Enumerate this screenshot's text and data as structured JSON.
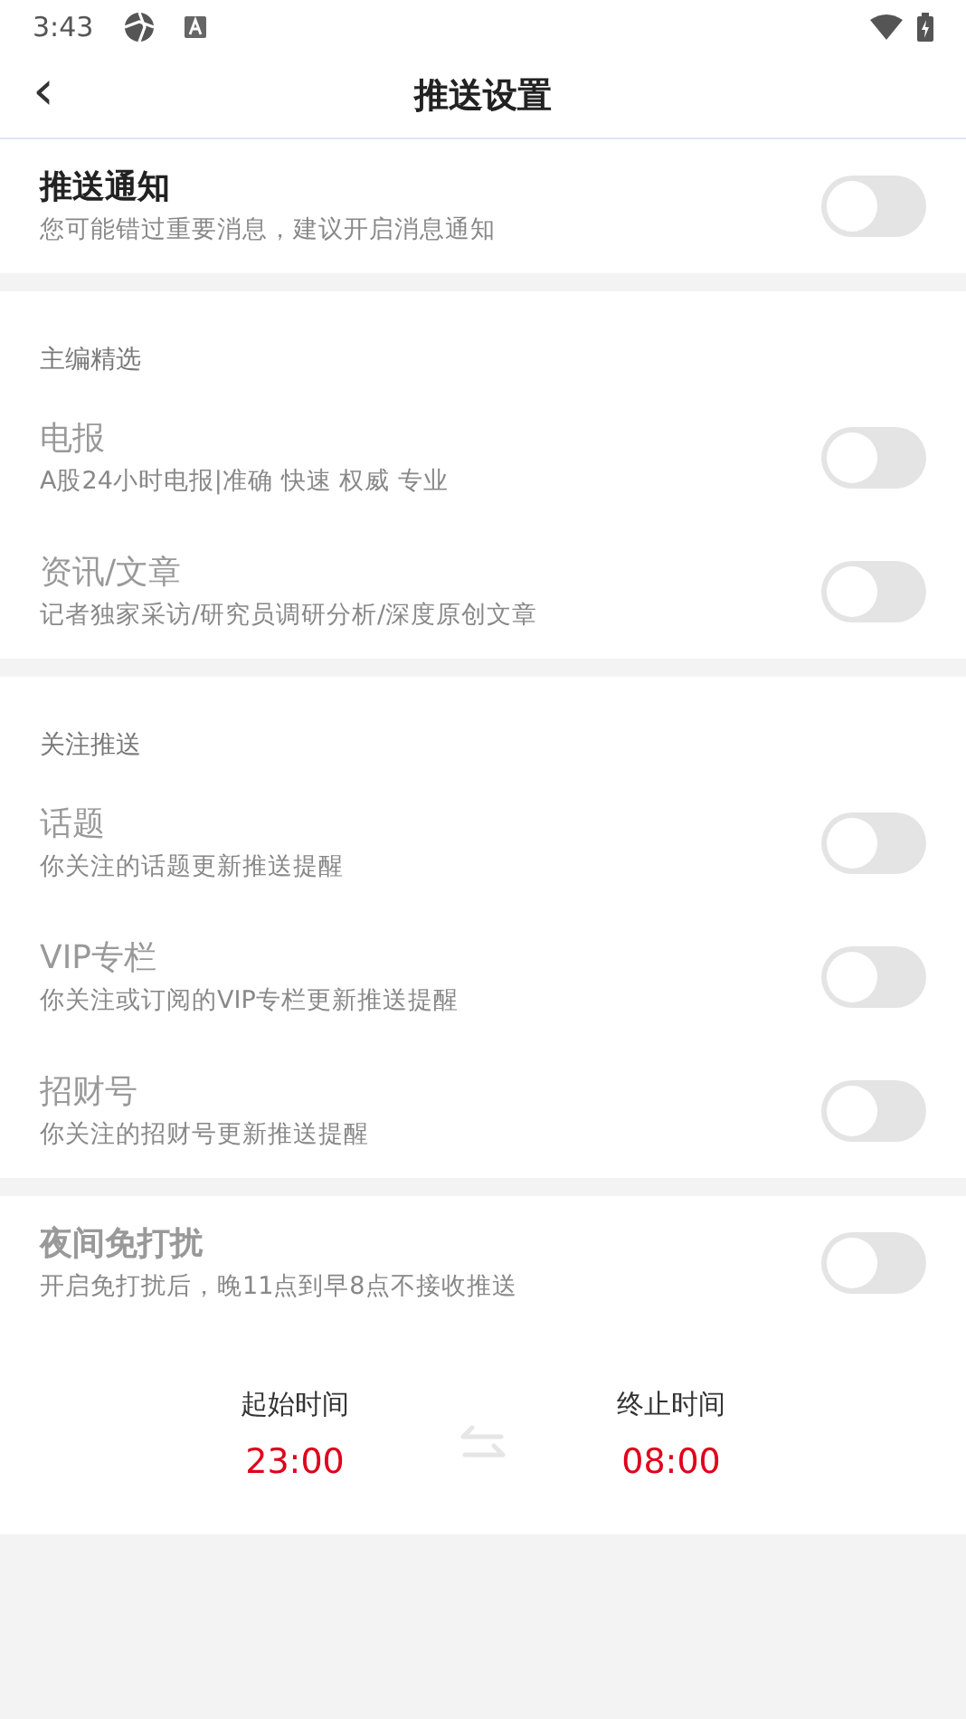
{
  "status_bar": {
    "time": "3:43"
  },
  "header": {
    "back": "‹",
    "title": "推送设置"
  },
  "sections": [
    {
      "items": [
        {
          "title": "推送通知",
          "subtitle": "您可能错过重要消息，建议开启消息通知",
          "bold": true,
          "disabled": false,
          "on": false
        }
      ]
    },
    {
      "heading": "主编精选",
      "items": [
        {
          "title": "电报",
          "subtitle": "A股24小时电报|准确 快速 权威 专业",
          "bold": false,
          "disabled": true,
          "on": false
        },
        {
          "title": "资讯/文章",
          "subtitle": "记者独家采访/研究员调研分析/深度原创文章",
          "bold": false,
          "disabled": true,
          "on": false
        }
      ]
    },
    {
      "heading": "关注推送",
      "items": [
        {
          "title": "话题",
          "subtitle": "你关注的话题更新推送提醒",
          "bold": false,
          "disabled": true,
          "on": false
        },
        {
          "title": "VIP专栏",
          "subtitle": "你关注或订阅的VIP专栏更新推送提醒",
          "bold": false,
          "disabled": true,
          "on": false
        },
        {
          "title": "招财号",
          "subtitle": "你关注的招财号更新推送提醒",
          "bold": false,
          "disabled": true,
          "on": false
        }
      ]
    },
    {
      "items": [
        {
          "title": "夜间免打扰",
          "subtitle": "开启免打扰后，晚11点到早8点不接收推送",
          "bold": true,
          "disabled": true,
          "on": false
        }
      ],
      "time_range": {
        "start_label": "起始时间",
        "start": "23:00",
        "end_label": "终止时间",
        "end": "08:00"
      }
    }
  ]
}
